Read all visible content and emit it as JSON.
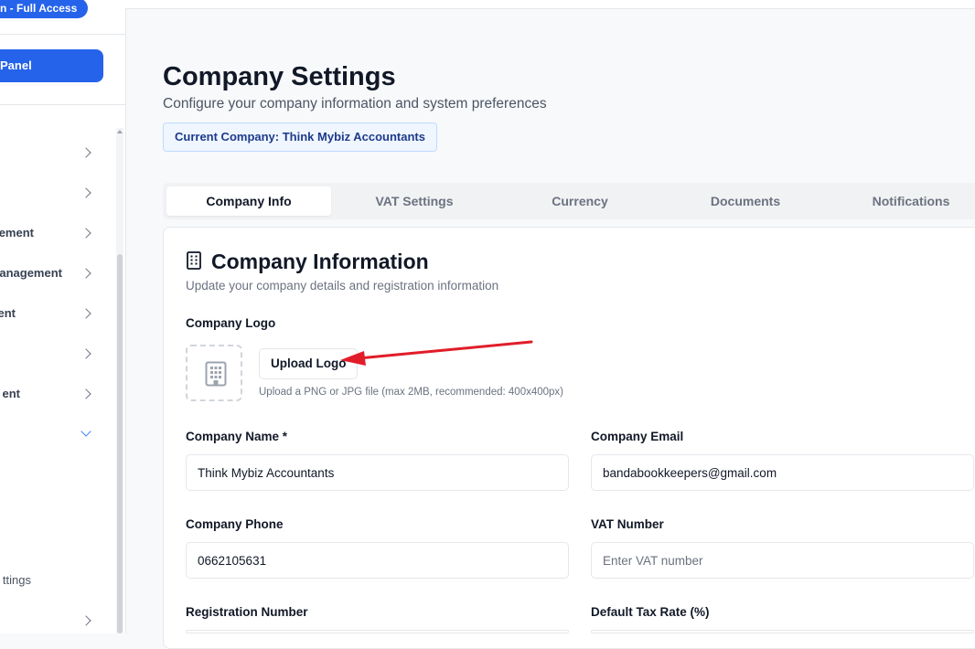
{
  "sidebar": {
    "role_badge": "n - Full Access",
    "panel_button": "Panel",
    "items": [
      {
        "label": ""
      },
      {
        "label": ""
      },
      {
        "label": "ement"
      },
      {
        "label": "anagement"
      },
      {
        "label": "ent"
      },
      {
        "label": ""
      },
      {
        "label": "ent"
      },
      {
        "label": ""
      },
      {
        "label": "ttings"
      },
      {
        "label": ""
      }
    ]
  },
  "header": {
    "title": "Company Settings",
    "subtitle": "Configure your company information and system preferences",
    "current_company": "Current Company: Think Mybiz Accountants"
  },
  "tabs": [
    {
      "label": "Company Info",
      "active": true
    },
    {
      "label": "VAT Settings",
      "active": false
    },
    {
      "label": "Currency",
      "active": false
    },
    {
      "label": "Documents",
      "active": false
    },
    {
      "label": "Notifications",
      "active": false
    }
  ],
  "company_info": {
    "title": "Company Information",
    "subtitle": "Update your company details and registration information",
    "logo_label": "Company Logo",
    "upload_button": "Upload Logo",
    "upload_hint": "Upload a PNG or JPG file (max 2MB, recommended: 400x400px)",
    "fields": {
      "company_name": {
        "label": "Company Name *",
        "value": "Think Mybiz Accountants"
      },
      "company_email": {
        "label": "Company Email",
        "value": "bandabookkeepers@gmail.com"
      },
      "company_phone": {
        "label": "Company Phone",
        "value": "0662105631"
      },
      "vat_number": {
        "label": "VAT Number",
        "value": "",
        "placeholder": "Enter VAT number"
      },
      "registration_number": {
        "label": "Registration Number"
      },
      "default_tax_rate": {
        "label": "Default Tax Rate (%)"
      }
    }
  },
  "colors": {
    "accent": "#2563eb",
    "annotation_arrow": "#e11d2a"
  },
  "icons": {
    "card_icon": "building-icon",
    "logo_placeholder": "building-icon",
    "annotation": "red-arrow"
  }
}
